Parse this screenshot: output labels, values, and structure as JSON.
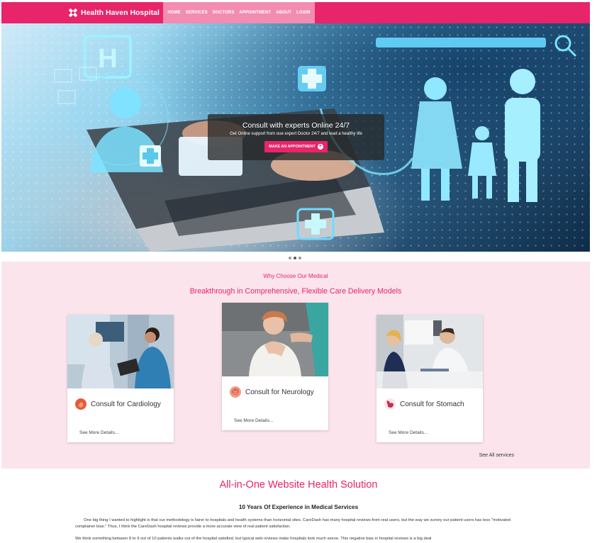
{
  "brand": {
    "name": "Health Haven Hospital"
  },
  "nav": {
    "items": [
      "HOME",
      "SERVICES",
      "DOCTORS",
      "APPOINTMENT",
      "ABOUT",
      "LOGIN"
    ]
  },
  "hero": {
    "title": "Consult with experts Online 24/7",
    "subtitle": "Get Online support from oue expert Doctor 24/7 and lead a healthy life",
    "button": "MAKE AN APPOINTMENT",
    "slide_count": 3,
    "active_slide": 1
  },
  "why": {
    "kicker": "Why Choose Our Medical",
    "title": "Breakthrough in Comprehensive, Flexible Care Delivery Models",
    "cards": [
      {
        "title": "Consult for Cardiology",
        "link": "See More Details..."
      },
      {
        "title": "Consult for Neurology",
        "link": "See More Details..."
      },
      {
        "title": "Consult for Stomach",
        "link": "See More Details..."
      }
    ],
    "see_all": "See All services"
  },
  "solution": {
    "title": "All-in-One Website Health Solution",
    "subtitle": "10 Years Of Experience in Medical Services",
    "paragraph1": "One big thing I wanted to highlight is that our methodology is fairer to hospitals and health systems than horizontal sites. CareDash has many hospital reviews from real users, but the way we survey our patient users has less \"motivated complainer bias.\" Thus, I think the CareDash hospital reviews provide a more accurate view of real patient satisfaction.",
    "paragraph2": "We think something between 8 to 9 out of 10 patients walks out of the hospital satisfied, but typical web reviews make hospitals look much worse. This negative bias in hospital reviews is a big deal"
  },
  "colors": {
    "primary": "#e8246a",
    "nav_active_bg": "#f28cb0",
    "section_bg": "#fbe4ec"
  },
  "icons": [
    "hospital-cross-logo-icon",
    "plus-circle-icon",
    "heart-organ-icon",
    "brain-organ-icon",
    "stomach-organ-icon"
  ]
}
